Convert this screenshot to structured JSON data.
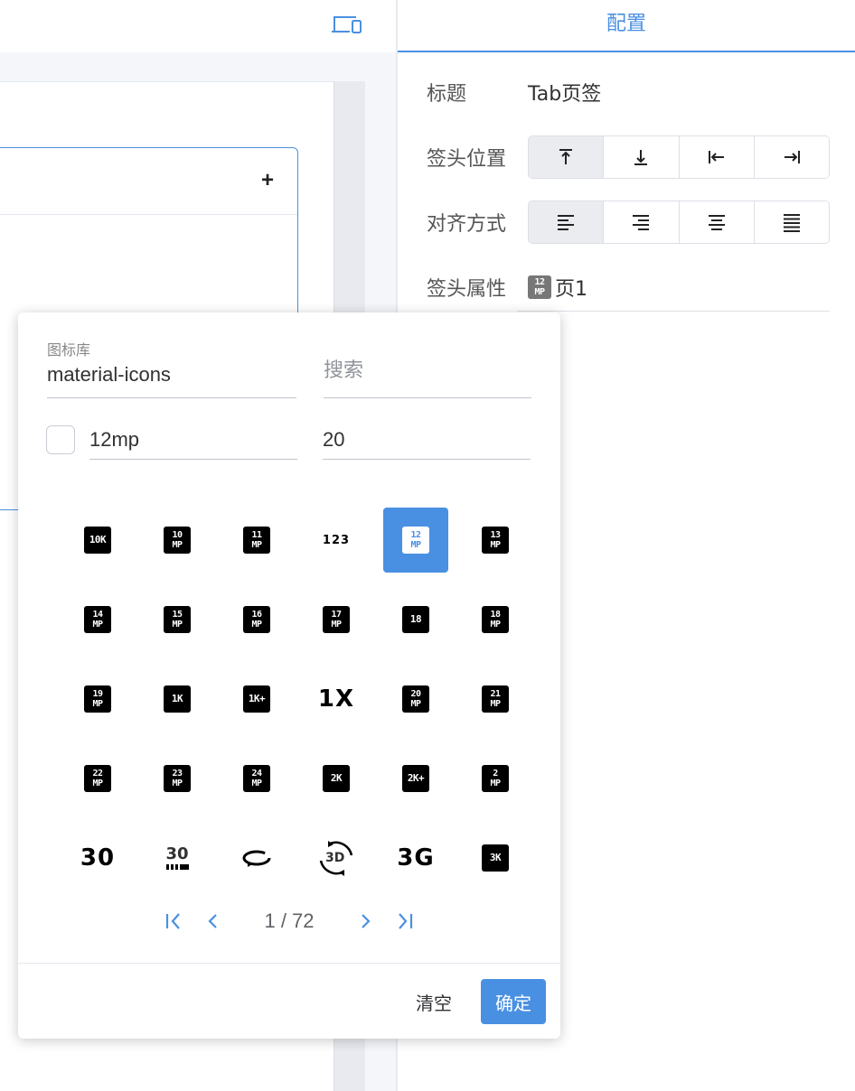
{
  "colors": {
    "accent": "#4a90e2",
    "active_segment": "#ebecef",
    "canvas_bg": "#f4f6fa"
  },
  "toolbar": {
    "device_icon": "devices-icon"
  },
  "panel": {
    "tab_label": "配置",
    "title_label": "标题",
    "title_value": "Tab页签",
    "position_label": "签头位置",
    "position_options": [
      "top",
      "bottom",
      "left",
      "right"
    ],
    "position_selected": "top",
    "align_label": "对齐方式",
    "align_options": [
      "left",
      "right",
      "center",
      "justify"
    ],
    "align_selected": "left",
    "attr_label": "签头属性",
    "attr_icon": "12mp",
    "attr_value": "页1"
  },
  "popover": {
    "library_label": "图标库",
    "library_value": "material-icons",
    "search_placeholder": "搜索",
    "filter_value": "12mp",
    "page_size": "20",
    "checkbox_checked": false,
    "icons": [
      {
        "name": "10k",
        "kind": "single",
        "text": "10K"
      },
      {
        "name": "10mp",
        "kind": "stack",
        "top": "10",
        "bottom": "MP"
      },
      {
        "name": "11mp",
        "kind": "stack",
        "top": "11",
        "bottom": "MP"
      },
      {
        "name": "123",
        "kind": "text",
        "text": "123"
      },
      {
        "name": "12mp",
        "kind": "stack",
        "top": "12",
        "bottom": "MP",
        "selected": true
      },
      {
        "name": "13mp",
        "kind": "stack",
        "top": "13",
        "bottom": "MP"
      },
      {
        "name": "14mp",
        "kind": "stack",
        "top": "14",
        "bottom": "MP"
      },
      {
        "name": "15mp",
        "kind": "stack",
        "top": "15",
        "bottom": "MP"
      },
      {
        "name": "16mp",
        "kind": "stack",
        "top": "16",
        "bottom": "MP"
      },
      {
        "name": "17mp",
        "kind": "stack",
        "top": "17",
        "bottom": "MP"
      },
      {
        "name": "18",
        "kind": "single",
        "text": "18"
      },
      {
        "name": "18mp",
        "kind": "stack",
        "top": "18",
        "bottom": "MP"
      },
      {
        "name": "19mp",
        "kind": "stack",
        "top": "19",
        "bottom": "MP"
      },
      {
        "name": "1k",
        "kind": "single",
        "text": "1K"
      },
      {
        "name": "1k-plus",
        "kind": "single",
        "text": "1K+"
      },
      {
        "name": "1x",
        "kind": "text-big",
        "text": "1X"
      },
      {
        "name": "20mp",
        "kind": "stack",
        "top": "20",
        "bottom": "MP"
      },
      {
        "name": "21mp",
        "kind": "stack",
        "top": "21",
        "bottom": "MP"
      },
      {
        "name": "22mp",
        "kind": "stack",
        "top": "22",
        "bottom": "MP"
      },
      {
        "name": "23mp",
        "kind": "stack",
        "top": "23",
        "bottom": "MP"
      },
      {
        "name": "24mp",
        "kind": "stack",
        "top": "24",
        "bottom": "MP"
      },
      {
        "name": "2k",
        "kind": "single",
        "text": "2K"
      },
      {
        "name": "2k-plus",
        "kind": "single",
        "text": "2K+"
      },
      {
        "name": "2mp",
        "kind": "stack",
        "top": "2",
        "bottom": "MP"
      },
      {
        "name": "30fps",
        "kind": "text-big",
        "text": "30"
      },
      {
        "name": "30fps-select",
        "kind": "30bar",
        "text": "30"
      },
      {
        "name": "360",
        "kind": "rotate"
      },
      {
        "name": "3d-rotation",
        "kind": "rotate3d",
        "text": "3D"
      },
      {
        "name": "3g-mobiledata",
        "kind": "text-big",
        "text": "3G"
      },
      {
        "name": "3k",
        "kind": "single",
        "text": "3K"
      }
    ],
    "pagination": {
      "current": "1",
      "total": "72",
      "display": "1 / 72"
    },
    "clear_label": "清空",
    "confirm_label": "确定"
  }
}
